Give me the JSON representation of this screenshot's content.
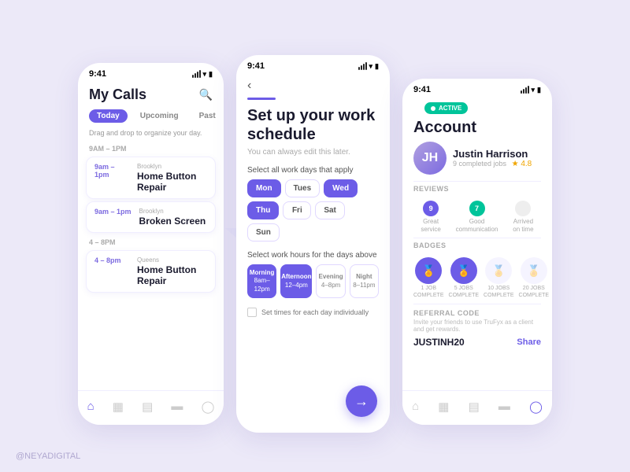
{
  "watermark": "@NEYADIGITAL",
  "phone1": {
    "status_time": "9:41",
    "title": "My Calls",
    "tabs": [
      "Today",
      "Upcoming",
      "Past"
    ],
    "hint": "Drag and drop to organize your day.",
    "time_block_1": "9AM – 1PM",
    "calls_am": [
      {
        "time": "9am – 1pm",
        "location": "Brooklyn",
        "title": "Home Button Repair"
      },
      {
        "time": "9am – 1pm",
        "location": "Brooklyn",
        "title": "Broken Screen"
      }
    ],
    "time_block_2": "4 – 8PM",
    "calls_pm": [
      {
        "time": "4 – 8pm",
        "location": "Queens",
        "title": "Home Button Repair"
      }
    ]
  },
  "phone2": {
    "status_time": "9:41",
    "heading": "Set up your work schedule",
    "subtext": "You can always edit this later.",
    "select_days_label": "Select all work days that apply",
    "days": [
      {
        "label": "Mon",
        "active": true
      },
      {
        "label": "Tues",
        "active": false
      },
      {
        "label": "Wed",
        "active": true
      },
      {
        "label": "Thu",
        "active": true
      },
      {
        "label": "Fri",
        "active": false
      },
      {
        "label": "Sat",
        "active": false
      },
      {
        "label": "Sun",
        "active": false
      }
    ],
    "hours_label": "Select work hours for the days above",
    "hours": [
      {
        "label": "Morning",
        "sublabel": "8am–12pm",
        "active": true
      },
      {
        "label": "Afternoon",
        "sublabel": "12–4pm",
        "active": true
      },
      {
        "label": "Evening",
        "sublabel": "4–8pm",
        "active": false
      },
      {
        "label": "Night",
        "sublabel": "8–11pm",
        "active": false
      }
    ],
    "checkbox_label": "Set times for each day individually"
  },
  "phone3": {
    "status_time": "9:41",
    "active_label": "ACTIVE",
    "account_title": "Account",
    "user_name": "Justin Harrison",
    "jobs_completed": "9 completed jobs",
    "rating": "4.8",
    "reviews_label": "REVIEWS",
    "reviews": [
      {
        "count": "9",
        "label": "Great\nservice",
        "color": "purple"
      },
      {
        "count": "7",
        "label": "Good\ncommunication",
        "color": "green"
      },
      {
        "label": "Arrived\non time",
        "color": "none"
      }
    ],
    "badges_label": "BADGES",
    "badges": [
      {
        "label": "1 JOB\nCOMPLETE",
        "active": true,
        "icon": "🏅"
      },
      {
        "label": "5 JOBS\nCOMPLETE",
        "active": true,
        "icon": "🏅"
      },
      {
        "label": "10 JOBS\nCOMPLETE",
        "active": false,
        "icon": "🏅"
      },
      {
        "label": "20 JOBS\nCOMPLETE",
        "active": false,
        "icon": "🏅"
      }
    ],
    "referral_label": "REFERRAL CODE",
    "referral_desc": "Invite your friends to use TruFyx as a client and get rewards.",
    "referral_code": "JUSTINH20",
    "share_label": "Share"
  }
}
